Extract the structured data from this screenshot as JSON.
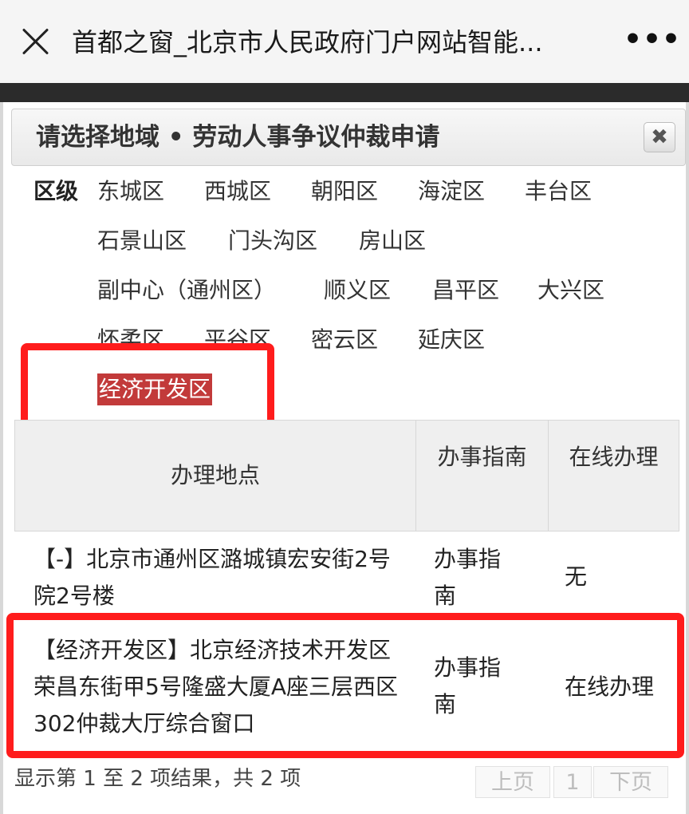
{
  "window": {
    "title": "首都之窗_北京市人民政府门户网站智能...",
    "more_label": "•••"
  },
  "dialog": {
    "title": "请选择地域 • 劳动人事争议仲裁申请",
    "close_label": "✖"
  },
  "region": {
    "label": "区级",
    "districts": [
      "东城区",
      "西城区",
      "朝阳区",
      "海淀区",
      "丰台区",
      "石景山区",
      "门头沟区",
      "房山区",
      "副中心（通州区）",
      "顺义区",
      "昌平区",
      "大兴区",
      "怀柔区",
      "平谷区",
      "密云区",
      "延庆区",
      "经济开发区"
    ],
    "selected": "经济开发区"
  },
  "table": {
    "headers": [
      "办理地点",
      "办事指南",
      "在线办理"
    ],
    "rows": [
      {
        "location": "【-】北京市通州区潞城镇宏安街2号院2号楼",
        "guide": "办事指南",
        "online": "无"
      },
      {
        "location": "【经济开发区】北京经济技术开发区荣昌东街甲5号隆盛大厦A座三层西区302仲裁大厅综合窗口",
        "guide": "办事指南",
        "online": "在线办理"
      }
    ]
  },
  "pagination": {
    "info": "显示第 1 至 2 项结果，共 2 项",
    "prev": "上页",
    "page": "1",
    "next": "下页"
  },
  "colors": {
    "selected_bg": "#c23a3a",
    "highlight_border": "#ff1c1c"
  }
}
